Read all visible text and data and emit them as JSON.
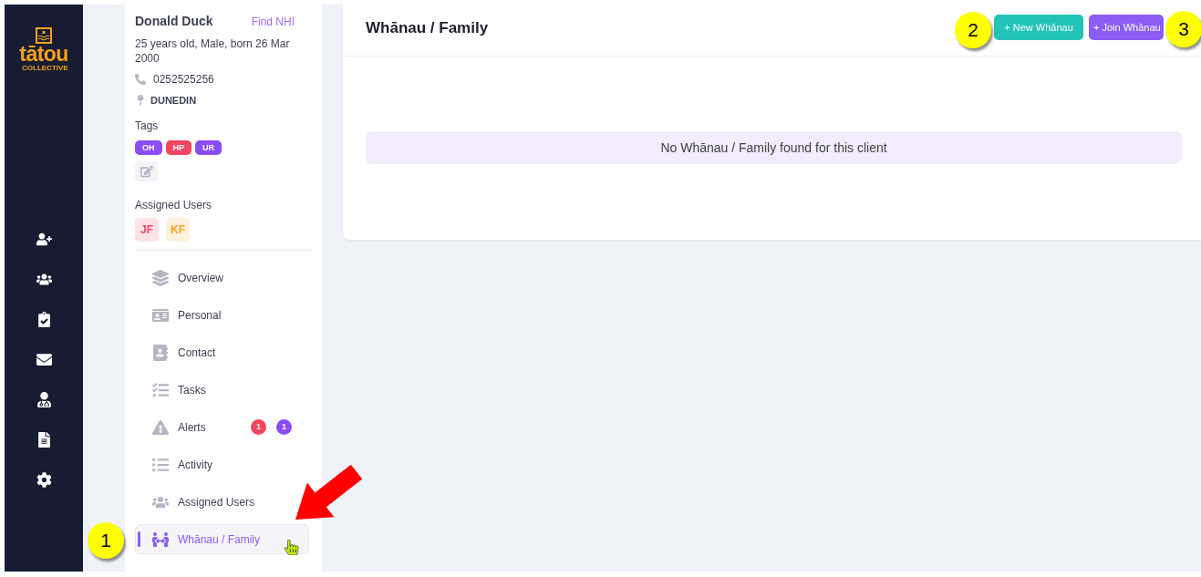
{
  "sidebar": {
    "logo": {
      "name": "tātou",
      "subtitle": "COLLECTIVE"
    }
  },
  "profile": {
    "name": "Donald Duck",
    "link": "Find NHI",
    "details": "25 years old, Male, born 26 Mar 2000",
    "phone": "0252525256",
    "location": "DUNEDIN",
    "tags_label": "Tags",
    "tags": [
      {
        "label": "OH",
        "color": "#8b4cf6"
      },
      {
        "label": "HP",
        "color": "#f2455f"
      },
      {
        "label": "UR",
        "color": "#8b4cf6"
      }
    ],
    "assigned_label": "Assigned Users",
    "assigned_users": [
      {
        "initials": "JF",
        "color": "#f2455f"
      },
      {
        "initials": "KF",
        "color": "#f6a21a"
      }
    ]
  },
  "nav": [
    {
      "label": "Overview",
      "selected": false
    },
    {
      "label": "Personal",
      "selected": false
    },
    {
      "label": "Contact",
      "selected": false
    },
    {
      "label": "Tasks",
      "selected": false
    },
    {
      "label": "Alerts",
      "selected": false,
      "badges": [
        {
          "count": "1",
          "color": "#f2455f"
        },
        {
          "count": "1",
          "color": "#8b4cf6"
        }
      ]
    },
    {
      "label": "Activity",
      "selected": false
    },
    {
      "label": "Assigned Users",
      "selected": false
    },
    {
      "label": "Whānau / Family",
      "selected": true
    }
  ],
  "main": {
    "title": "Whānau / Family",
    "buttons": [
      {
        "label": "+ New Whānau",
        "color": "#22c3b8"
      },
      {
        "label": "+ Join Whānau",
        "color": "#8b5cf6"
      }
    ],
    "empty_message": "No Whānau / Family found for this client"
  },
  "annotations": {
    "markers": [
      {
        "label": "1"
      },
      {
        "label": "2"
      },
      {
        "label": "3"
      }
    ]
  }
}
